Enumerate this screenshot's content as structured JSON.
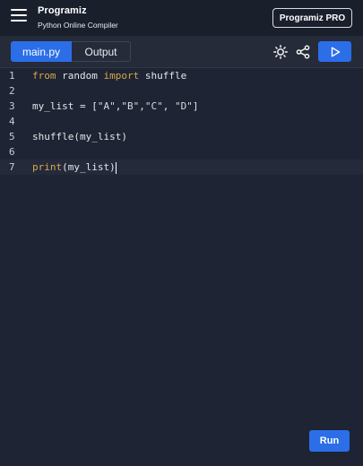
{
  "header": {
    "logo": "Programiz",
    "subtitle": "Python Online Compiler",
    "pro_button": "Programiz PRO"
  },
  "tabs": [
    {
      "label": "main.py",
      "active": true
    },
    {
      "label": "Output",
      "active": false
    }
  ],
  "toolbar": {
    "theme_icon": "sun-icon",
    "share_icon": "share-icon",
    "run_icon": "play-icon"
  },
  "editor": {
    "lines": [
      {
        "number": "1",
        "text": "from random import shuffle"
      },
      {
        "number": "2",
        "text": ""
      },
      {
        "number": "3",
        "text": "my_list = [\"A\",\"B\",\"C\", \"D\"]"
      },
      {
        "number": "4",
        "text": ""
      },
      {
        "number": "5",
        "text": "shuffle(my_list)"
      },
      {
        "number": "6",
        "text": ""
      },
      {
        "number": "7",
        "text": "print(my_list)"
      }
    ],
    "active_line": 7
  },
  "run_button": "Run",
  "colors": {
    "accent": "#2b6ee8",
    "background": "#1e2433",
    "keyword": "#d5a94a"
  }
}
